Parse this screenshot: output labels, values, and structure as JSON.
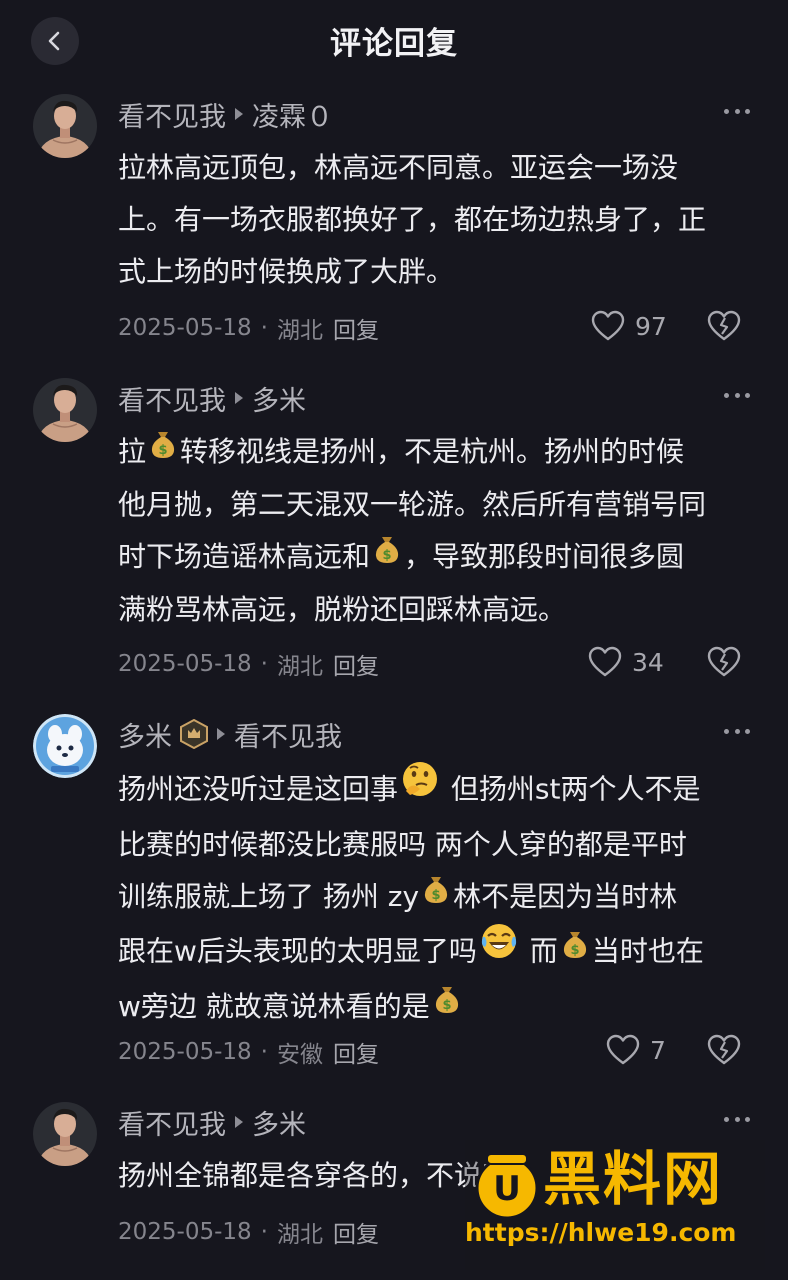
{
  "header": {
    "title": "评论回复",
    "back_icon": "chevron-left-icon"
  },
  "comments": [
    {
      "author": "看不见我",
      "reply_to": "凌霖０",
      "lines": [
        "拉林高远顶包，林高远不同意。亚运会一场没",
        "上。有一场衣服都换好了，都在场边热身了，正",
        "式上场的时候换成了大胖。"
      ],
      "date": "2025-05-18",
      "location": "湖北",
      "reply_label": "回复",
      "likes": "97"
    },
    {
      "author": "看不见我",
      "reply_to": "多米",
      "lines": [
        {
          "a": "拉",
          "b": "转移视线是扬州，不是杭州。扬州的时候"
        },
        "他月抛，第二天混双一轮游。然后所有营销号同",
        {
          "a": "时下场造谣林高远和",
          "b": "，导致那段时间很多圆"
        },
        "满粉骂林高远，脱粉还回踩林高远。"
      ],
      "date": "2025-05-18",
      "location": "湖北",
      "reply_label": "回复",
      "likes": "34"
    },
    {
      "author": "多米",
      "reply_to": "看不见我",
      "lines": [
        {
          "a": "扬州还没听过是这回事",
          "b": " 但扬州st两个人不是"
        },
        "比赛的时候都没比赛服吗  两个人穿的都是平时",
        {
          "a": "训练服就上场了  扬州 zy",
          "b": "林不是因为当时林"
        },
        {
          "a": "跟在w后头表现的太明显了吗",
          "b": " 而",
          "c": "当时也在"
        },
        {
          "a": "w旁边   就故意说林看的是"
        }
      ],
      "date": "2025-05-18",
      "location": "安徽",
      "reply_label": "回复",
      "likes": "7"
    },
    {
      "author": "看不见我",
      "reply_to": "多米",
      "lines": [
        "扬州全锦都是各穿各的，不说哪"
      ],
      "date": "2025-05-18",
      "location": "湖北",
      "reply_label": "回复"
    }
  ],
  "watermark": {
    "brand": "黑料网",
    "url": "https://hlwe19.com"
  },
  "icons": {
    "like": "heart-icon",
    "dislike": "broken-heart-icon",
    "more": "more-dots-icon",
    "reply_arrow": "triangle-right-icon",
    "money": "money-bag-emoji-icon",
    "thinking": "thinking-face-emoji-icon",
    "laughing": "crying-laughing-emoji-icon",
    "badge": "fan-badge-icon"
  },
  "colors": {
    "background": "#16161e",
    "text": "#ececf0",
    "muted": "#85858d",
    "watermark": "#f6b800"
  }
}
